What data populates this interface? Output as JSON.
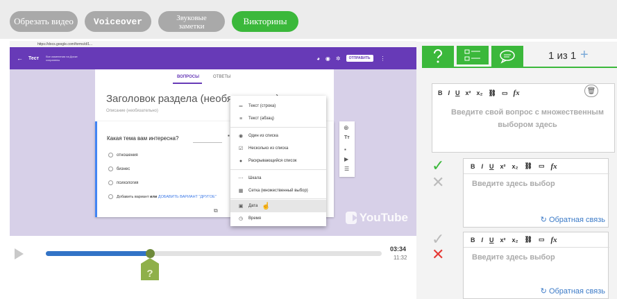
{
  "toolbar": {
    "tabs": [
      {
        "label": "Обрезать видео"
      },
      {
        "label": "Voiceover"
      },
      {
        "label_line1": "Звуковые",
        "label_line2": "заметки"
      },
      {
        "label": "Викторины"
      }
    ]
  },
  "video": {
    "url": "https://docs.google.com/forms/d/1...",
    "form_title": "Тест",
    "form_subtitle": "Все изменения на Диске сохранены",
    "send_label": "ОТПРАВИТЬ",
    "tab_questions": "ВОПРОСЫ",
    "tab_answers": "ОТВЕТЫ",
    "section_title": "Заголовок раздела (необязательно)",
    "section_description": "Описание (необязательно)",
    "question": "Какая тема вам интересна?",
    "options": [
      "отношения",
      "бизнес",
      "психология"
    ],
    "add_option": "Добавить вариант",
    "add_option_or": "или",
    "add_other": "ДОБАВИТЬ ВАРИАНТ \"ДРУГОЕ\"",
    "menu": [
      {
        "icon": "short-text-icon",
        "glyph": "═",
        "label": "Текст (строка)"
      },
      {
        "icon": "paragraph-icon",
        "glyph": "≡",
        "label": "Текст (абзац)"
      },
      {
        "icon": "radio-icon",
        "glyph": "◉",
        "label": "Один из списка"
      },
      {
        "icon": "checkbox-icon",
        "glyph": "☑",
        "label": "Несколько из списка"
      },
      {
        "icon": "dropdown-icon",
        "glyph": "●",
        "label": "Раскрывающийся список"
      },
      {
        "icon": "scale-icon",
        "glyph": "⋯",
        "label": "Шкала"
      },
      {
        "icon": "grid-icon",
        "glyph": "▦",
        "label": "Сетка (множественный выбор)"
      },
      {
        "icon": "date-icon",
        "glyph": "▣",
        "label": "Дата"
      },
      {
        "icon": "time-icon",
        "glyph": "◷",
        "label": "Время"
      }
    ],
    "youtube_label": "YouTube"
  },
  "player": {
    "current_time": "03:34",
    "duration": "11:32",
    "progress": 0.31,
    "marker_label": "?"
  },
  "panel": {
    "counter": "1 из 1",
    "plus": "+",
    "question_placeholder": "Введите свой вопрос с множественным выбором здесь",
    "answer_placeholder": "Введите здесь выбор",
    "feedback_label": "Обратная связь",
    "toolbar_bold": "B",
    "toolbar_italic": "I",
    "toolbar_underline": "U",
    "toolbar_sup": "x²",
    "toolbar_sub": "x₂",
    "toolbar_fx": "fx",
    "trash_glyph": "🗑",
    "accent_color": "#3bb83b"
  }
}
